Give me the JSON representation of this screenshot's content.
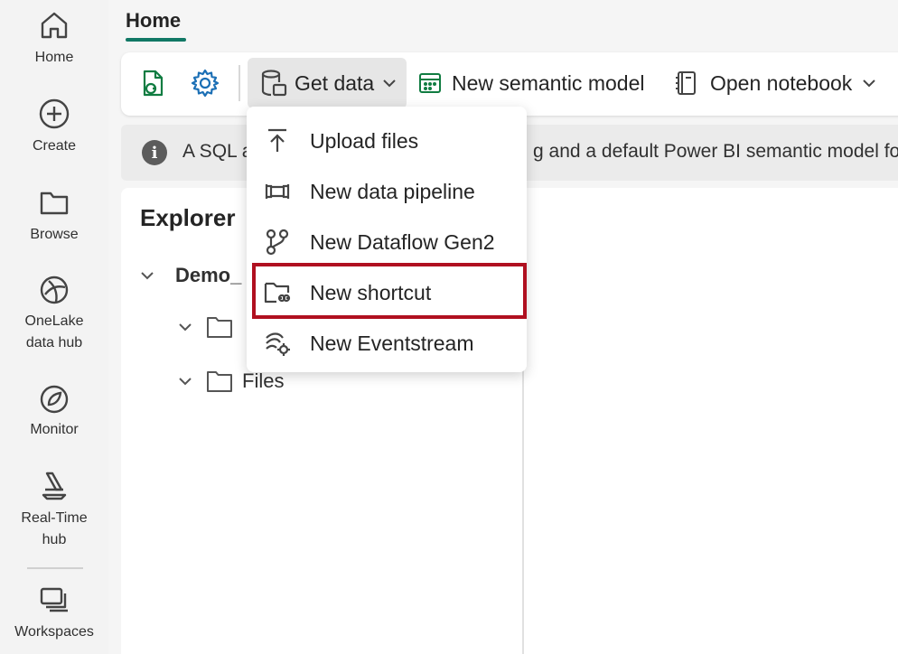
{
  "rail": {
    "items": [
      {
        "label": "Home",
        "icon": "home-icon"
      },
      {
        "label": "Create",
        "icon": "plus-circle-icon"
      },
      {
        "label": "Browse",
        "icon": "folder-icon"
      },
      {
        "label": "OneLake\ndata hub",
        "icon": "onelake-icon"
      },
      {
        "label": "Monitor",
        "icon": "monitor-icon"
      },
      {
        "label": "Real-Time\nhub",
        "icon": "realtime-icon"
      },
      {
        "label": "Workspaces",
        "icon": "workspaces-icon"
      }
    ]
  },
  "header": {
    "tab": "Home"
  },
  "toolbar": {
    "get_data": "Get data",
    "new_semantic_model": "New semantic model",
    "open_notebook": "Open notebook"
  },
  "info": {
    "text_left": "A SQL a",
    "text_right": "g and a default Power BI semantic model for r"
  },
  "explorer": {
    "title": "Explorer",
    "root": "Demo_",
    "folders": [
      "Files"
    ]
  },
  "dropdown": {
    "items": [
      {
        "label": "Upload files",
        "icon": "upload-icon"
      },
      {
        "label": "New data pipeline",
        "icon": "pipeline-icon"
      },
      {
        "label": "New Dataflow Gen2",
        "icon": "dataflow-icon"
      },
      {
        "label": "New shortcut",
        "icon": "shortcut-icon"
      },
      {
        "label": "New Eventstream",
        "icon": "eventstream-icon"
      }
    ]
  },
  "colors": {
    "accent": "#117865",
    "highlight": "#b01020"
  }
}
